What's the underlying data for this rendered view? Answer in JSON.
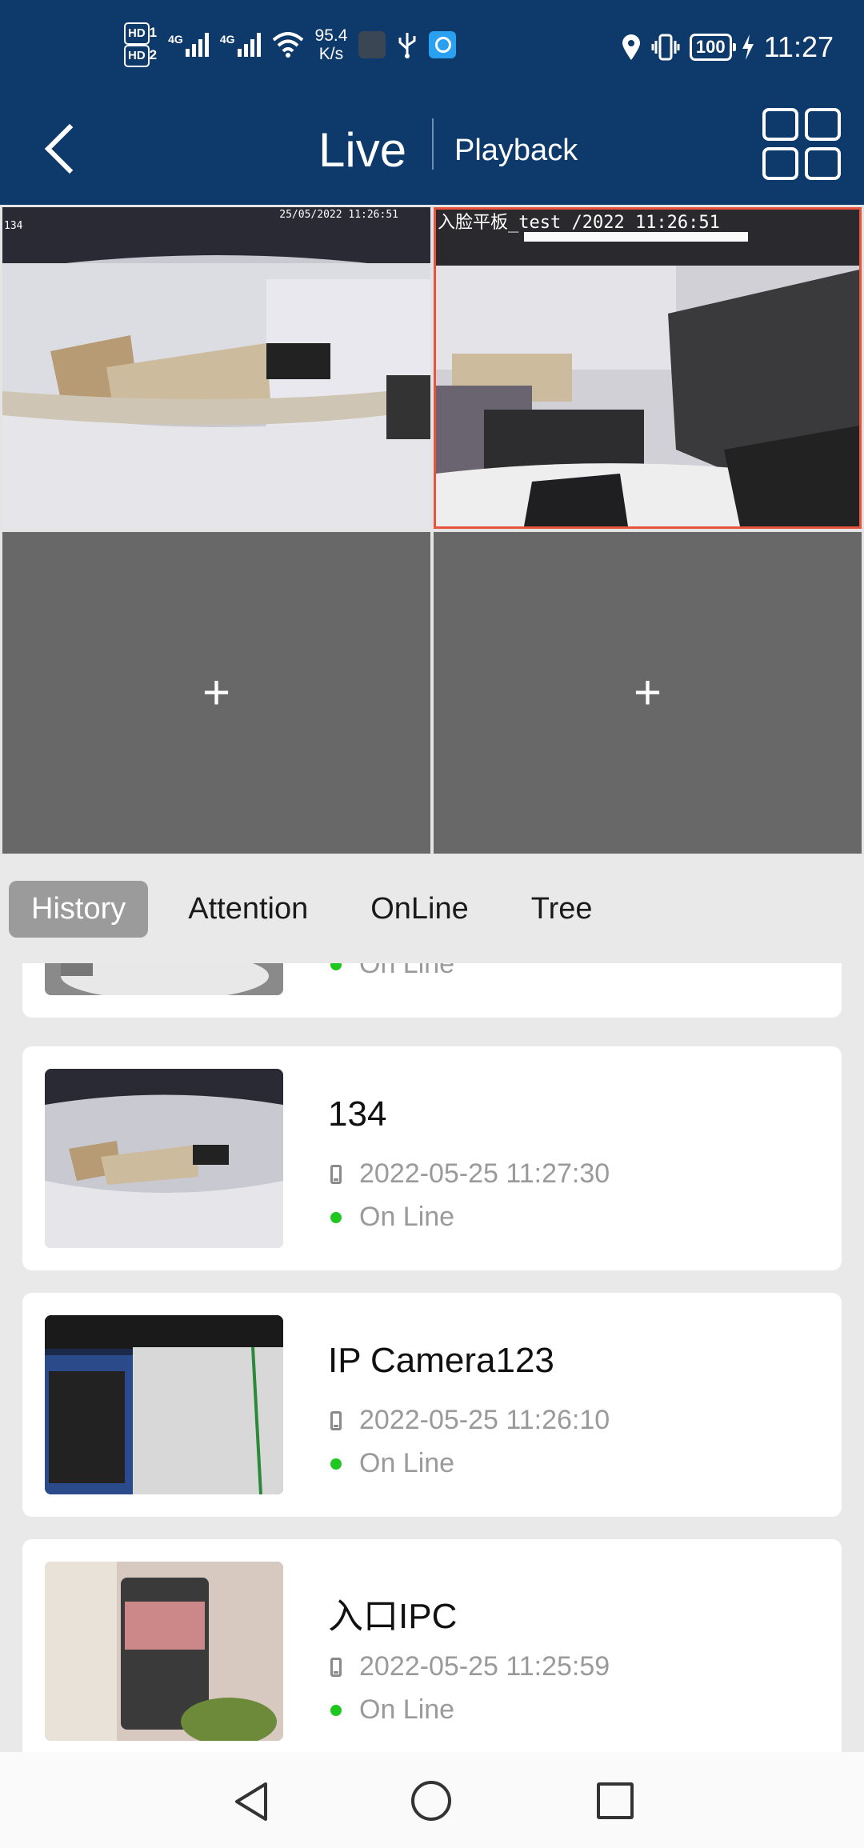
{
  "status_bar": {
    "hd1": "HD",
    "hd1_num": "1",
    "hd2": "HD",
    "hd2_num": "2",
    "net1": "4G",
    "net2": "4G",
    "speed_value": "95.4",
    "speed_unit": "K/s",
    "battery": "100",
    "time": "11:27"
  },
  "header": {
    "title": "Live",
    "playback": "Playback"
  },
  "video_tiles": [
    {
      "timestamp": "25/05/2022 11:26:51",
      "corner": "134"
    },
    {
      "timestamp": "入脸平板_test /2022 11:26:51"
    },
    {
      "add": "+"
    },
    {
      "add": "+"
    }
  ],
  "tabs": [
    "History",
    "Attention",
    "OnLine",
    "Tree"
  ],
  "devices": [
    {
      "name": "",
      "time": "",
      "status": "On Line"
    },
    {
      "name": "134",
      "time": "2022-05-25 11:27:30",
      "status": "On Line"
    },
    {
      "name": "IP Camera123",
      "time": "2022-05-25 11:26:10",
      "status": "On Line"
    },
    {
      "name": "入口IPC",
      "time": "2022-05-25 11:25:59",
      "status": "On Line"
    }
  ],
  "colors": {
    "header_bg": "#0d3a6b",
    "active_tile_border": "#e8533b",
    "online_dot": "#1ec81e",
    "active_tab_bg": "#9b9b9b"
  }
}
